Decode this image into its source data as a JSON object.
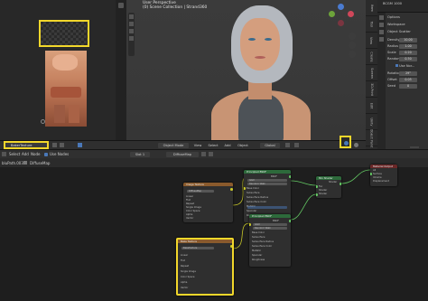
{
  "image_editor": {
    "header_label": "BakerTexture"
  },
  "viewport": {
    "perspective_label": "User Perspective",
    "collection_label": "(0) Scene Collection | Strand360",
    "header": {
      "mode": "Object Mode",
      "menus": [
        "View",
        "Select",
        "Add",
        "Object"
      ],
      "transform_orientation": "Global"
    }
  },
  "outliner": {
    "top_item": "BCGM 1000"
  },
  "sidebar_tabs": [
    "Item",
    "Tool",
    "View",
    "Create",
    "Screen",
    "3D-Print",
    "Edit",
    "Unity",
    "Object Paint"
  ],
  "properties": {
    "rows": [
      {
        "label": "Options"
      },
      {
        "label": "Workspace"
      },
      {
        "label": "Object Scatter"
      },
      {
        "label": "Density",
        "value": "10.00"
      },
      {
        "label": "Radius",
        "value": "1.00"
      },
      {
        "label": "Scale",
        "value": "0.20"
      },
      {
        "label": "Random...",
        "value": "0.50"
      },
      {
        "label": "Use Nor..."
      },
      {
        "label": "Rotation",
        "value": "29°"
      },
      {
        "label": "Offset",
        "value": "0.05"
      },
      {
        "label": "Seed",
        "value": "0"
      }
    ]
  },
  "node_editor": {
    "menus": [
      "Select",
      "Add",
      "Node"
    ],
    "use_nodes_label": "Use Nodes",
    "slot_label": "Slot 1",
    "material_name": "DiffuseMap",
    "breadcrumb": [
      "bluPath.003",
      "DiffuseMap"
    ],
    "nodes": {
      "image_texture_1": {
        "title": "Image Texture",
        "image": "DiffuseMap",
        "rows": [
          "Linear",
          "Flat",
          "Repeat",
          "Single Image",
          "Color Space",
          "Alpha",
          "Vector"
        ]
      },
      "image_texture_2": {
        "title": "Bake Texture",
        "image": "BakeTexture",
        "rows": [
          "Linear",
          "Flat",
          "Repeat",
          "Single Image",
          "Color Space",
          "Alpha",
          "Vector"
        ]
      },
      "bsdf_1": {
        "title": "Principled BSDF",
        "rows": [
          "BSDF",
          "GGX",
          "Random Walk",
          "Base Color",
          "Subsurface",
          "Subsurface Radius",
          "Subsurface Color",
          "Metallic",
          "Specular",
          "Roughness"
        ]
      },
      "bsdf_2": {
        "title": "Principled BSDF",
        "rows": [
          "BSDF",
          "GGX",
          "Random Walk",
          "Base Color",
          "Subsurface",
          "Subsurface Radius",
          "Subsurface Color",
          "Metallic",
          "Specular",
          "Roughness"
        ]
      },
      "mix": {
        "title": "Mix Shader",
        "rows": [
          "Shader",
          "Fac",
          "Shader",
          "Shader"
        ]
      },
      "output": {
        "title": "Material Output",
        "rows": [
          "All",
          "Surface",
          "Volume",
          "Displacement"
        ]
      }
    }
  },
  "colors": {
    "highlight": "#f2d72b",
    "texture_node_header": "#8a5a2c",
    "shader_node_header": "#2d6a3b",
    "output_node_header": "#6a2727",
    "socket_color": "#c7c729",
    "socket_shader": "#63c763",
    "socket_vector": "#6363c7"
  }
}
